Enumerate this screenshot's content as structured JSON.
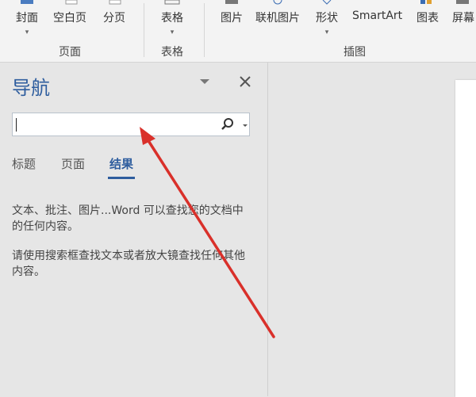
{
  "ribbon": {
    "items": [
      {
        "label": "封面",
        "caret": "▾"
      },
      {
        "label": "空白页"
      },
      {
        "label": "分页"
      },
      {
        "label": "表格",
        "caret": "▾"
      },
      {
        "label": "图片"
      },
      {
        "label": "联机图片"
      },
      {
        "label": "形状",
        "caret": "▾"
      },
      {
        "label": "SmartArt"
      },
      {
        "label": "图表"
      },
      {
        "label": "屏幕"
      }
    ],
    "groups": [
      "页面",
      "表格",
      "插图"
    ]
  },
  "nav": {
    "title": "导航",
    "search": {
      "value": "",
      "placeholder": ""
    },
    "tabs": [
      "标题",
      "页面",
      "结果"
    ],
    "active_tab": "结果",
    "message1": "文本、批注、图片...Word 可以查找您的文档中的任何内容。",
    "message2": "请使用搜索框查找文本或者放大镜查找任何其他内容。"
  },
  "colors": {
    "accent": "#2e5d9e",
    "annotation_arrow": "#d9302a"
  }
}
